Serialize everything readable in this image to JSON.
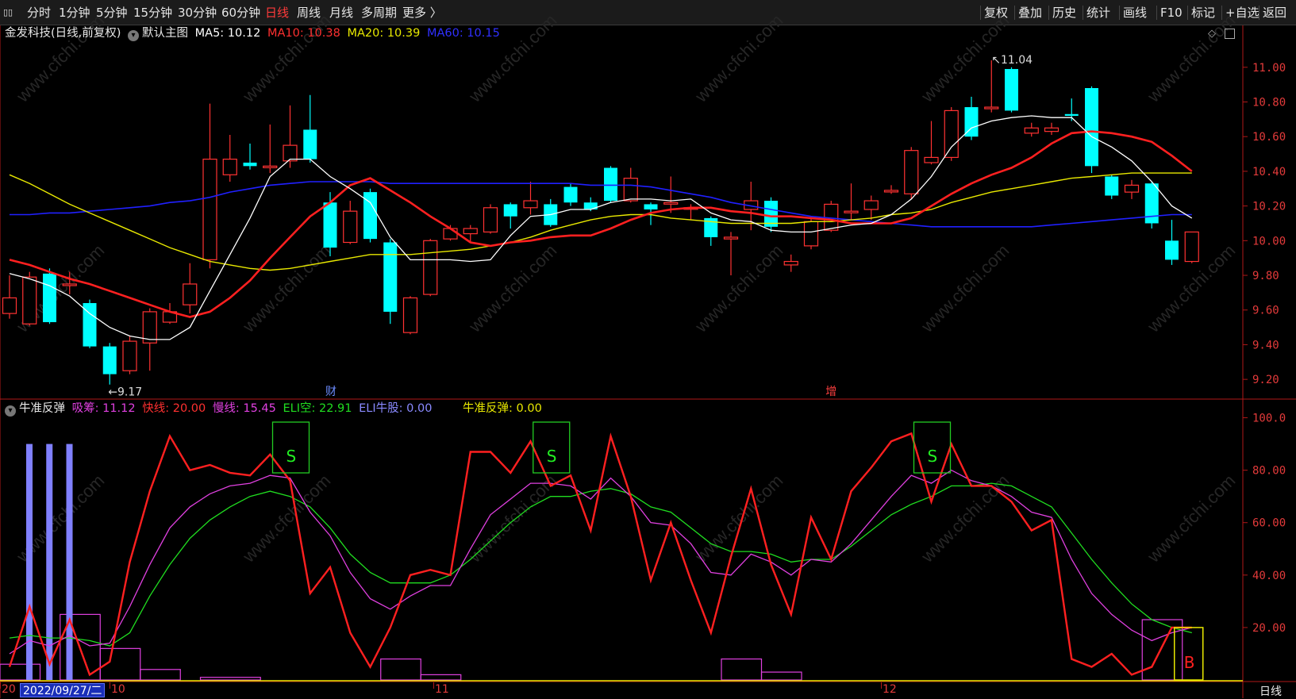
{
  "toolbar": {
    "periods": [
      "分时",
      "1分钟",
      "5分钟",
      "15分钟",
      "30分钟",
      "60分钟",
      "日线",
      "周线",
      "月线",
      "多周期",
      "更多 〉"
    ],
    "active_period": "日线",
    "right_items": [
      "复权",
      "叠加",
      "历史",
      "统计",
      "画线",
      "F10",
      "标记",
      "+自选",
      "返回"
    ]
  },
  "main_chart": {
    "title": "金发科技(日线,前复权)",
    "template": "默认主图",
    "ma5": "MA5: 10.12",
    "ma10": "MA10: 10.38",
    "ma20": "MA20: 10.39",
    "ma60": "MA60: 10.15",
    "high_label": "11.04",
    "low_label": "9.17",
    "marker_cai": "财",
    "marker_zeng": "增",
    "y_ticks": [
      "11.00",
      "10.80",
      "10.60",
      "10.40",
      "10.20",
      "10.00",
      "9.80",
      "9.60",
      "9.40",
      "9.20"
    ]
  },
  "indicator": {
    "name": "牛准反弹",
    "xichou": "吸筹: 11.12",
    "kuaixian": "快线: 20.00",
    "manxian": "慢线: 15.45",
    "eli_kong": "ELI空: 22.91",
    "eli_niugu": "ELI牛股: 0.00",
    "niuzhun": "牛准反弹: 0.00",
    "y_ticks": [
      "100.0",
      "80.00",
      "60.00",
      "40.00",
      "20.00"
    ],
    "sell_label": "S",
    "buy_label": "B"
  },
  "x_axis": {
    "labels": [
      "20",
      "10",
      "11",
      "12"
    ],
    "cursor_date": "2022/09/27/二",
    "period": "日线"
  },
  "colors": {
    "up": "#ff3232",
    "down": "#00ffff",
    "ma5": "#ffffff",
    "ma10": "#ff2020",
    "ma20": "#e8e800",
    "ma60": "#2020ff",
    "axis": "#b01818",
    "kuaixian": "#ff2020",
    "manxian": "#e040e0",
    "eli_kong": "#20dd20",
    "eli_niugu": "#8080ff",
    "niuzhun": "#e8e800"
  },
  "chart_data": [
    {
      "type": "candlestick",
      "ylim": [
        9.1,
        11.15
      ],
      "candles": [
        [
          9.58,
          9.67,
          9.55,
          9.8
        ],
        [
          9.52,
          9.79,
          9.51,
          9.82
        ],
        [
          9.81,
          9.53,
          9.52,
          9.84
        ],
        [
          9.75,
          9.75,
          9.69,
          9.82
        ],
        [
          9.64,
          9.39,
          9.38,
          9.66
        ],
        [
          9.39,
          9.23,
          9.17,
          9.41
        ],
        [
          9.25,
          9.42,
          9.23,
          9.45
        ],
        [
          9.41,
          9.59,
          9.25,
          9.61
        ],
        [
          9.53,
          9.59,
          9.52,
          9.64
        ],
        [
          9.63,
          9.75,
          9.58,
          9.87
        ],
        [
          9.89,
          10.47,
          9.84,
          10.79
        ],
        [
          10.38,
          10.47,
          10.34,
          10.61
        ],
        [
          10.45,
          10.43,
          10.41,
          10.56
        ],
        [
          10.43,
          10.43,
          10.39,
          10.67
        ],
        [
          10.46,
          10.55,
          10.42,
          10.78
        ],
        [
          10.64,
          10.47,
          10.45,
          10.84
        ],
        [
          10.22,
          9.96,
          9.91,
          10.28
        ],
        [
          9.99,
          10.17,
          9.98,
          10.23
        ],
        [
          10.28,
          10.01,
          9.99,
          10.3
        ],
        [
          9.99,
          9.59,
          9.52,
          10.01
        ],
        [
          9.47,
          9.67,
          9.46,
          9.68
        ],
        [
          9.69,
          10.0,
          9.68,
          10.01
        ],
        [
          10.01,
          10.07,
          10.0,
          10.09
        ],
        [
          10.04,
          10.07,
          9.99,
          10.09
        ],
        [
          10.05,
          10.19,
          10.04,
          10.21
        ],
        [
          10.21,
          10.14,
          10.07,
          10.22
        ],
        [
          10.19,
          10.23,
          10.15,
          10.34
        ],
        [
          10.21,
          10.09,
          10.08,
          10.24
        ],
        [
          10.31,
          10.22,
          10.2,
          10.33
        ],
        [
          10.22,
          10.18,
          10.17,
          10.25
        ],
        [
          10.42,
          10.23,
          10.22,
          10.43
        ],
        [
          10.23,
          10.36,
          10.22,
          10.42
        ],
        [
          10.21,
          10.18,
          10.09,
          10.22
        ],
        [
          10.22,
          10.22,
          10.16,
          10.37
        ],
        [
          10.19,
          10.19,
          10.12,
          10.21
        ],
        [
          10.13,
          10.02,
          9.97,
          10.14
        ],
        [
          10.01,
          10.02,
          9.8,
          10.05
        ],
        [
          10.18,
          10.23,
          10.06,
          10.34
        ],
        [
          10.23,
          10.08,
          10.05,
          10.25
        ],
        [
          9.86,
          9.88,
          9.82,
          9.92
        ],
        [
          9.97,
          10.11,
          9.95,
          10.13
        ],
        [
          10.06,
          10.21,
          10.05,
          10.23
        ],
        [
          10.17,
          10.17,
          10.12,
          10.33
        ],
        [
          10.18,
          10.23,
          10.12,
          10.26
        ],
        [
          10.29,
          10.29,
          10.27,
          10.32
        ],
        [
          10.27,
          10.52,
          10.24,
          10.54
        ],
        [
          10.45,
          10.48,
          10.44,
          10.69
        ],
        [
          10.48,
          10.75,
          10.46,
          10.77
        ],
        [
          10.77,
          10.6,
          10.58,
          10.83
        ],
        [
          10.77,
          10.77,
          10.74,
          11.04
        ],
        [
          10.99,
          10.75,
          10.74,
          11.0
        ],
        [
          10.62,
          10.65,
          10.6,
          10.68
        ],
        [
          10.63,
          10.65,
          10.61,
          10.68
        ],
        [
          10.73,
          10.72,
          10.69,
          10.82
        ],
        [
          10.88,
          10.43,
          10.39,
          10.89
        ],
        [
          10.37,
          10.26,
          10.24,
          10.38
        ],
        [
          10.28,
          10.32,
          10.24,
          10.35
        ],
        [
          10.33,
          10.1,
          10.07,
          10.34
        ],
        [
          10.0,
          9.89,
          9.86,
          10.12
        ],
        [
          9.88,
          10.05,
          9.87,
          10.05
        ]
      ],
      "ma5": [
        9.81,
        9.78,
        9.74,
        9.68,
        9.58,
        9.5,
        9.45,
        9.43,
        9.43,
        9.5,
        9.71,
        9.92,
        10.13,
        10.37,
        10.47,
        10.47,
        10.37,
        10.3,
        10.22,
        10.02,
        9.89,
        9.89,
        9.89,
        9.88,
        9.89,
        10.03,
        10.14,
        10.15,
        10.18,
        10.18,
        10.22,
        10.24,
        10.24,
        10.23,
        10.24,
        10.16,
        10.12,
        10.11,
        10.06,
        10.05,
        10.05,
        10.07,
        10.09,
        10.1,
        10.15,
        10.24,
        10.37,
        10.54,
        10.65,
        10.69,
        10.71,
        10.72,
        10.71,
        10.71,
        10.6,
        10.54,
        10.46,
        10.34,
        10.2,
        10.13
      ],
      "ma10": [
        9.89,
        9.86,
        9.82,
        9.78,
        9.75,
        9.71,
        9.67,
        9.63,
        9.59,
        9.56,
        9.59,
        9.67,
        9.77,
        9.9,
        10.02,
        10.14,
        10.22,
        10.32,
        10.36,
        10.29,
        10.22,
        10.14,
        10.07,
        9.99,
        9.97,
        9.99,
        10.0,
        10.02,
        10.03,
        10.03,
        10.07,
        10.12,
        10.16,
        10.18,
        10.19,
        10.19,
        10.17,
        10.16,
        10.14,
        10.14,
        10.13,
        10.12,
        10.1,
        10.1,
        10.1,
        10.13,
        10.2,
        10.27,
        10.33,
        10.38,
        10.42,
        10.48,
        10.56,
        10.62,
        10.63,
        10.62,
        10.6,
        10.57,
        10.49,
        10.4
      ],
      "ma20": [
        10.38,
        10.33,
        10.27,
        10.21,
        10.16,
        10.11,
        10.06,
        10.01,
        9.96,
        9.92,
        9.88,
        9.86,
        9.84,
        9.83,
        9.84,
        9.86,
        9.88,
        9.9,
        9.92,
        9.92,
        9.92,
        9.93,
        9.94,
        9.95,
        9.97,
        9.99,
        10.02,
        10.06,
        10.09,
        10.12,
        10.14,
        10.15,
        10.15,
        10.13,
        10.12,
        10.11,
        10.1,
        10.1,
        10.1,
        10.1,
        10.11,
        10.11,
        10.12,
        10.13,
        10.15,
        10.16,
        10.18,
        10.22,
        10.25,
        10.28,
        10.3,
        10.32,
        10.34,
        10.36,
        10.37,
        10.38,
        10.39,
        10.39,
        10.39,
        10.39
      ],
      "ma60": [
        10.15,
        10.15,
        10.16,
        10.16,
        10.17,
        10.18,
        10.19,
        10.2,
        10.22,
        10.23,
        10.25,
        10.28,
        10.3,
        10.32,
        10.33,
        10.34,
        10.34,
        10.34,
        10.34,
        10.33,
        10.33,
        10.33,
        10.33,
        10.33,
        10.33,
        10.33,
        10.33,
        10.33,
        10.33,
        10.32,
        10.32,
        10.32,
        10.31,
        10.29,
        10.27,
        10.25,
        10.22,
        10.2,
        10.18,
        10.16,
        10.14,
        10.13,
        10.12,
        10.11,
        10.1,
        10.09,
        10.08,
        10.08,
        10.08,
        10.08,
        10.08,
        10.08,
        10.09,
        10.1,
        10.11,
        10.12,
        10.13,
        10.14,
        10.15,
        10.15
      ]
    },
    {
      "type": "line",
      "ylim": [
        0,
        105
      ],
      "kuaixian": [
        5,
        28,
        6,
        23,
        2,
        7,
        45,
        72,
        93,
        80,
        82,
        79,
        78,
        86,
        76,
        33,
        43,
        18,
        5,
        20,
        40,
        42,
        40,
        87,
        87,
        79,
        91,
        74,
        78,
        57,
        93,
        70,
        38,
        60,
        38,
        18,
        47,
        73,
        44,
        25,
        62,
        46,
        72,
        81,
        91,
        94,
        68,
        90,
        74,
        74,
        68,
        57,
        61,
        8,
        5,
        10,
        2,
        5,
        20,
        20
      ],
      "manxian": [
        10,
        15,
        13,
        17,
        13,
        14,
        28,
        44,
        58,
        66,
        71,
        74,
        75,
        78,
        77,
        64,
        55,
        41,
        31,
        27,
        32,
        36,
        36,
        50,
        63,
        69,
        75,
        75,
        74,
        69,
        77,
        70,
        60,
        59,
        52,
        41,
        40,
        48,
        45,
        40,
        46,
        45,
        52,
        61,
        70,
        78,
        75,
        80,
        76,
        74,
        70,
        64,
        62,
        46,
        33,
        25,
        19,
        15,
        18,
        20
      ],
      "eli_kong": [
        16,
        17,
        16,
        16,
        15,
        13,
        18,
        32,
        44,
        54,
        61,
        66,
        70,
        72,
        70,
        66,
        58,
        48,
        41,
        37,
        37,
        37,
        40,
        46,
        53,
        60,
        66,
        70,
        70,
        72,
        73,
        71,
        66,
        64,
        58,
        52,
        49,
        49,
        48,
        45,
        46,
        46,
        51,
        57,
        63,
        67,
        70,
        74,
        74,
        75,
        74,
        70,
        66,
        56,
        46,
        37,
        29,
        23,
        20,
        18
      ],
      "eli_niugu": [
        90,
        90,
        90,
        0,
        0,
        0,
        0,
        0,
        0,
        0,
        0,
        0,
        0,
        0,
        0,
        0,
        0,
        0,
        0,
        0,
        0,
        0,
        0,
        0,
        0,
        0,
        0,
        0,
        0,
        0,
        0,
        0,
        0,
        0,
        0,
        0,
        0,
        0,
        0,
        0,
        0,
        0,
        0,
        0,
        0,
        0,
        0,
        0,
        0,
        0,
        0,
        0,
        0,
        0,
        0,
        0,
        0,
        0,
        0,
        0
      ],
      "niuzhun": [
        0,
        0,
        0,
        0,
        0,
        0,
        0,
        0,
        0,
        0,
        0,
        0,
        0,
        0,
        0,
        0,
        0,
        0,
        0,
        0,
        0,
        0,
        0,
        0,
        0,
        0,
        0,
        0,
        0,
        0,
        0,
        0,
        0,
        0,
        0,
        0,
        0,
        0,
        0,
        0,
        0,
        0,
        0,
        0,
        0,
        0,
        0,
        0,
        0,
        0,
        0,
        0,
        0,
        0,
        0,
        0,
        0,
        0,
        0,
        20
      ],
      "xichou_bars": [
        [
          0,
          2,
          6
        ],
        [
          3,
          5,
          25
        ],
        [
          5,
          7,
          12
        ],
        [
          7,
          9,
          4
        ],
        [
          10,
          13,
          1
        ],
        [
          19,
          21,
          8
        ],
        [
          21,
          23,
          2
        ],
        [
          36,
          38,
          8
        ],
        [
          38,
          40,
          3
        ],
        [
          57,
          59,
          23
        ]
      ],
      "sell_signals": [
        14,
        27,
        46
      ],
      "buy_signals": [
        59
      ]
    }
  ]
}
